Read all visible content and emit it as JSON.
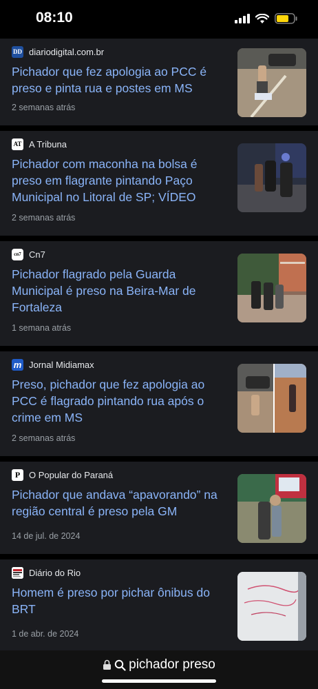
{
  "status": {
    "time": "08:10"
  },
  "articles": [
    {
      "source": "diariodigital.com.br",
      "logo_text": "DD",
      "title": "Pichador que fez apologia ao PCC é preso e pinta rua e postes em MS",
      "age": "2 semanas atrás"
    },
    {
      "source": "A Tribuna",
      "logo_text": "AT",
      "title": "Pichador com maconha na bolsa é preso em flagrante pintando Paço Municipal no Litoral de SP; VÍDEO",
      "age": "2 semanas atrás"
    },
    {
      "source": "Cn7",
      "logo_text": "cn7",
      "title": "Pichador flagrado pela Guarda Municipal é preso na Beira-Mar de Fortaleza",
      "age": "1 semana atrás"
    },
    {
      "source": "Jornal Midiamax",
      "logo_text": "m",
      "title": "Preso, pichador que fez apologia ao PCC é flagrado pintando rua após o crime em MS",
      "age": "2 semanas atrás"
    },
    {
      "source": "O Popular do Paraná",
      "logo_text": "P",
      "title": "Pichador que andava “apavorando” na região central é preso pela GM",
      "age": "14 de jul. de 2024"
    },
    {
      "source": "Diário do Rio",
      "logo_text": "",
      "title": "Homem é preso por pichar ônibus do BRT",
      "age": "1 de abr. de 2024"
    }
  ],
  "search": {
    "query": "pichador preso"
  }
}
